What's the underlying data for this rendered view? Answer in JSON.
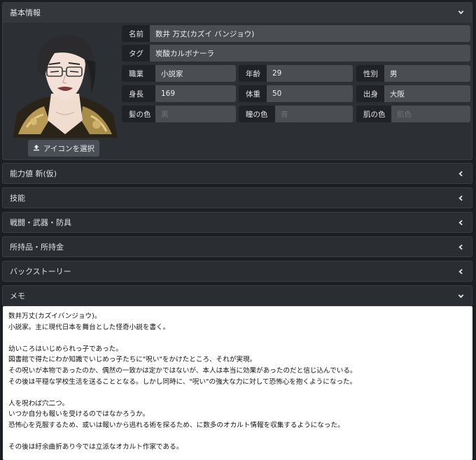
{
  "sections": {
    "basic": "基本情報",
    "ability": "能力値 新(仮)",
    "skills": "技能",
    "combat": "戦闘・武器・防具",
    "items": "所持品・所持金",
    "backstory": "バックストーリー",
    "memo": "メモ"
  },
  "upload_label": "アイコンを選択",
  "fields": {
    "name": {
      "label": "名前",
      "value": "数井 万丈(カズイ バンジョウ)"
    },
    "tag": {
      "label": "タグ",
      "value": "炭酸カルボナーラ"
    },
    "job": {
      "label": "職業",
      "value": "小説家"
    },
    "age": {
      "label": "年齢",
      "value": "29"
    },
    "gender": {
      "label": "性別",
      "value": "男"
    },
    "height": {
      "label": "身長",
      "value": "169"
    },
    "weight": {
      "label": "体重",
      "value": "50"
    },
    "origin": {
      "label": "出身",
      "value": "大阪"
    },
    "hair": {
      "label": "髪の色",
      "placeholder": "黒"
    },
    "eye": {
      "label": "瞳の色",
      "placeholder": "青"
    },
    "skin": {
      "label": "肌の色",
      "placeholder": "肌色"
    }
  },
  "memo_lines": [
    "数井万丈(カズイバンジョウ)。",
    "小説家。主に現代日本を舞台とした怪奇小説を書く。",
    "",
    "幼いころはいじめられっ子であった。",
    "図書館で得たにわか知識でいじめっ子たちに\"呪い\"をかけたところ、それが実現。",
    "その呪いが本物であったのか、偶然の一致かは定かではないが、本人は本当に効果があったのだと信じ込んでいる。",
    "その後は平穏な学校生活を送ることとなる。しかし同時に、\"呪い\"の強大な力に対して恐怖心を抱くようになった。",
    "",
    "人を呪わば穴二つ。",
    "いつか自分も報いを受けるのではなかろうか。",
    "恐怖心を克服するため、或いは報いから逃れる術を探るため、に数多のオカルト情報を収集するようになった。",
    "",
    "その後は紆余曲折あり今では立派なオカルト作家である。"
  ]
}
